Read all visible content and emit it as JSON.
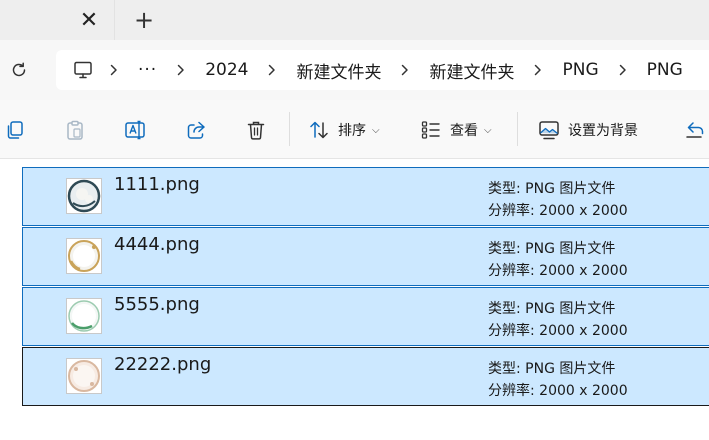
{
  "tabbar": {
    "close_glyph": "✕",
    "add_glyph": "+"
  },
  "address": {
    "overflow": "···",
    "breadcrumbs": [
      "2024",
      "新建文件夹",
      "新建文件夹",
      "PNG",
      "PNG"
    ]
  },
  "toolbar": {
    "sort_label": "排序",
    "view_label": "查看",
    "set_background_label": "设置为背景"
  },
  "files": [
    {
      "name": "1111.png",
      "type": "类型: PNG 图片文件",
      "resolution": "分辨率: 2000 x 2000",
      "thumb_colors": [
        "#e9eef0",
        "#2f4a55",
        "#f5f5f2"
      ]
    },
    {
      "name": "4444.png",
      "type": "类型: PNG 图片文件",
      "resolution": "分辨率: 2000 x 2000",
      "thumb_colors": [
        "#f4f3ee",
        "#c9a35a",
        "#ffffff"
      ]
    },
    {
      "name": "5555.png",
      "type": "类型: PNG 图片文件",
      "resolution": "分辨率: 2000 x 2000",
      "thumb_colors": [
        "#f3f7f5",
        "#4a9e6a",
        "#ffffff"
      ]
    },
    {
      "name": "22222.png",
      "type": "类型: PNG 图片文件",
      "resolution": "分辨率: 2000 x 2000",
      "thumb_colors": [
        "#f7ebe3",
        "#d9b8a0",
        "#fbf6f2"
      ]
    }
  ],
  "colors": {
    "selection_fill": "#cce8ff",
    "selection_border": "#0f6cbd",
    "focus_border": "#1a1a1a",
    "tab_bg": "#eeeeee"
  }
}
